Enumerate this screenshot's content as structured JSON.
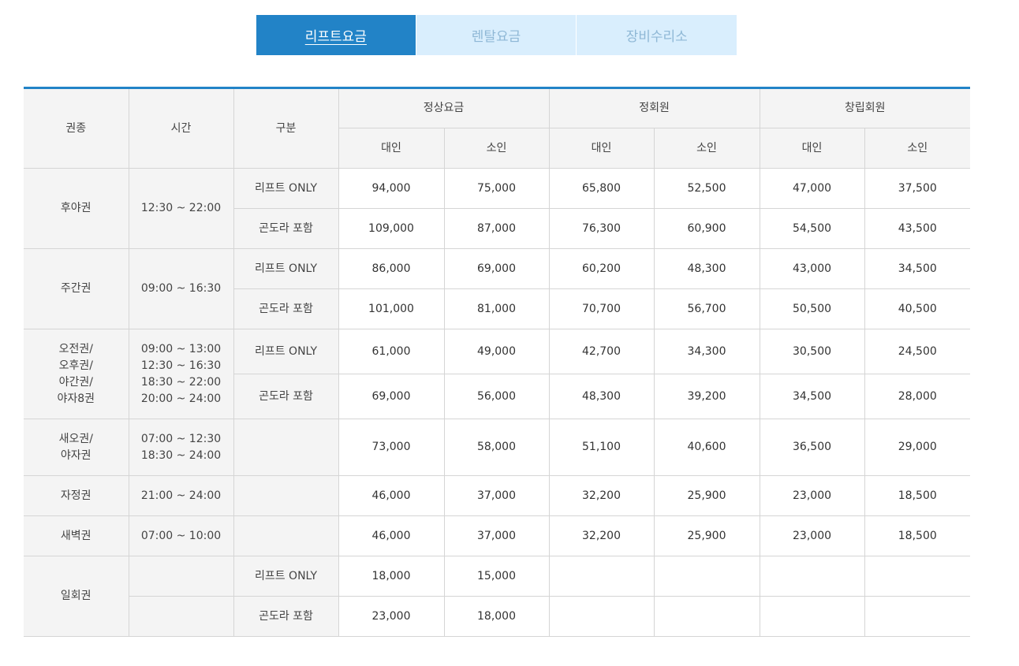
{
  "tabs": [
    {
      "label": "리프트요금",
      "active": true
    },
    {
      "label": "렌탈요금",
      "active": false
    },
    {
      "label": "장비수리소",
      "active": false
    }
  ],
  "colors": {
    "accent": "#2283c7",
    "tab_inactive_bg": "#d9eefd",
    "header_bg": "#f4f4f4"
  },
  "table": {
    "headers": {
      "ticket_type": "권종",
      "time": "시간",
      "category": "구분",
      "groups": [
        "정상요금",
        "정회원",
        "창립회원"
      ],
      "adult": "대인",
      "child": "소인"
    },
    "rows": [
      {
        "ticket": "후야권",
        "time": "12:30 ~ 22:00",
        "sub": [
          {
            "category": "리프트 ONLY",
            "prices": [
              "94,000",
              "75,000",
              "65,800",
              "52,500",
              "47,000",
              "37,500"
            ]
          },
          {
            "category": "곤도라 포함",
            "prices": [
              "109,000",
              "87,000",
              "76,300",
              "60,900",
              "54,500",
              "43,500"
            ]
          }
        ]
      },
      {
        "ticket": "주간권",
        "time": "09:00 ~ 16:30",
        "sub": [
          {
            "category": "리프트 ONLY",
            "prices": [
              "86,000",
              "69,000",
              "60,200",
              "48,300",
              "43,000",
              "34,500"
            ]
          },
          {
            "category": "곤도라 포함",
            "prices": [
              "101,000",
              "81,000",
              "70,700",
              "56,700",
              "50,500",
              "40,500"
            ]
          }
        ]
      },
      {
        "ticket_lines": [
          "오전권/",
          "오후권/",
          "야간권/",
          "야자8권"
        ],
        "time_lines": [
          "09:00 ~ 13:00",
          "12:30 ~ 16:30",
          "18:30 ~ 22:00",
          "20:00 ~ 24:00"
        ],
        "sub": [
          {
            "category": "리프트 ONLY",
            "prices": [
              "61,000",
              "49,000",
              "42,700",
              "34,300",
              "30,500",
              "24,500"
            ]
          },
          {
            "category": "곤도라 포함",
            "prices": [
              "69,000",
              "56,000",
              "48,300",
              "39,200",
              "34,500",
              "28,000"
            ]
          }
        ]
      },
      {
        "ticket_lines": [
          "새오권/",
          "야자권"
        ],
        "time_lines": [
          "07:00 ~ 12:30",
          "18:30 ~ 24:00"
        ],
        "prices": [
          "73,000",
          "58,000",
          "51,100",
          "40,600",
          "36,500",
          "29,000"
        ]
      },
      {
        "ticket": "자정권",
        "time": "21:00 ~ 24:00",
        "prices": [
          "46,000",
          "37,000",
          "32,200",
          "25,900",
          "23,000",
          "18,500"
        ]
      },
      {
        "ticket": "새벽권",
        "time": "07:00 ~ 10:00",
        "prices": [
          "46,000",
          "37,000",
          "32,200",
          "25,900",
          "23,000",
          "18,500"
        ]
      },
      {
        "ticket": "일회권",
        "sub": [
          {
            "category": "리프트 ONLY",
            "prices": [
              "18,000",
              "15,000"
            ]
          },
          {
            "category": "곤도라 포함",
            "prices": [
              "23,000",
              "18,000"
            ]
          }
        ]
      }
    ]
  }
}
